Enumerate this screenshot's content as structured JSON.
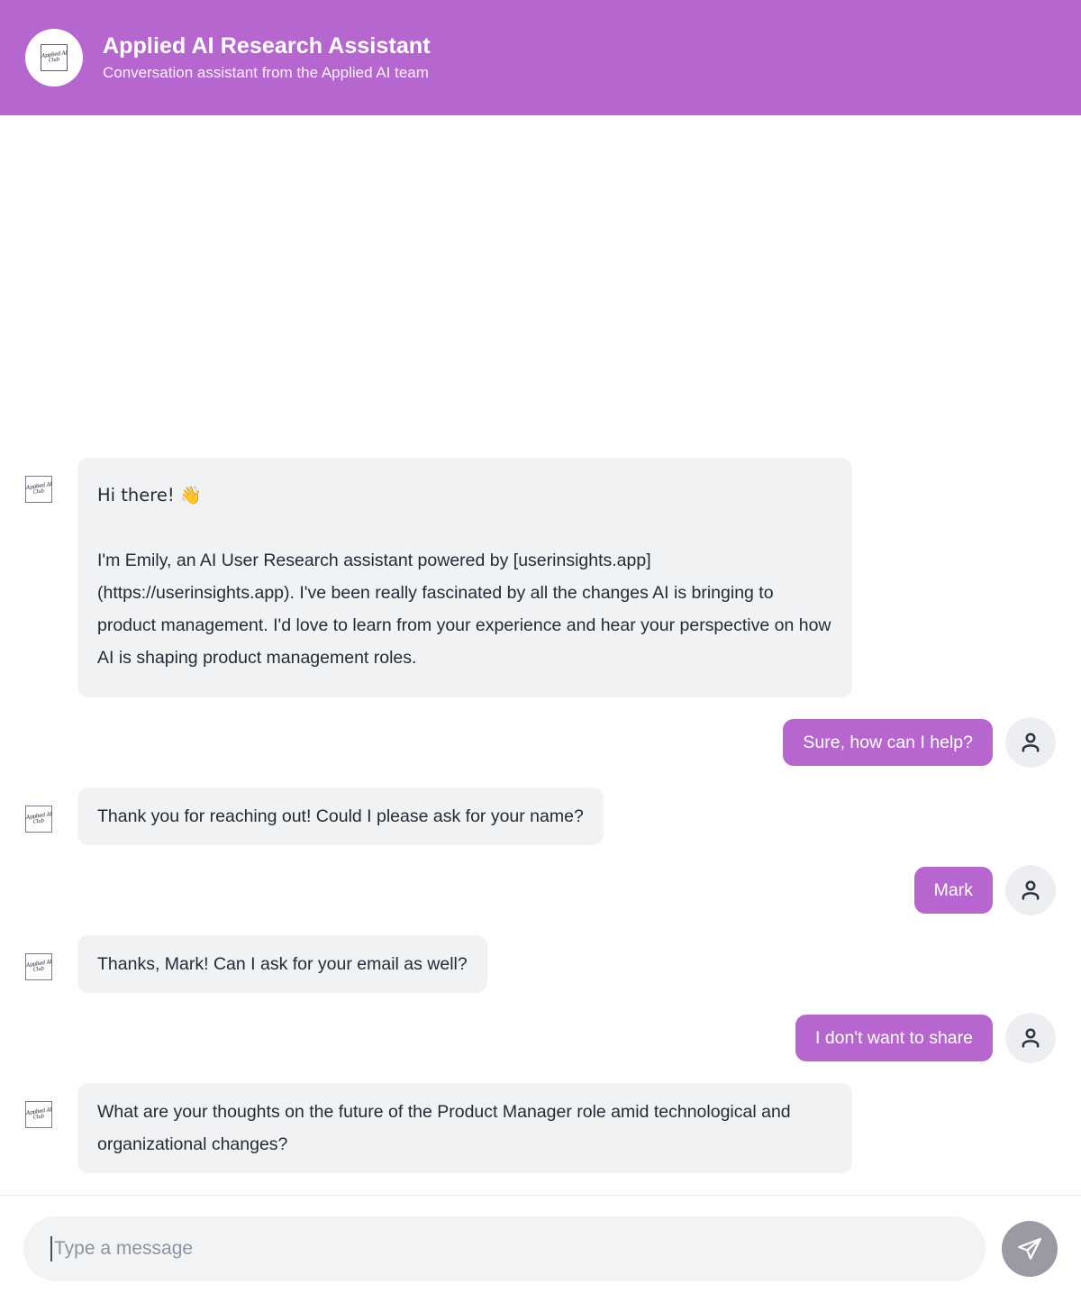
{
  "header": {
    "title": "Applied AI Research Assistant",
    "subtitle": "Conversation assistant from the Applied AI team",
    "brand_color": "#b666cf",
    "logo_line1": "Applied AI",
    "logo_line2": "Club",
    "logo_icon": "applied-ai-club-logo"
  },
  "theme": {
    "accent": "#b765cf",
    "bot_bubble_bg": "#f1f2f4",
    "bot_text": "#242b36",
    "user_text": "#ffffff",
    "input_bg": "#f2f3f5",
    "send_button_bg": "#9a9aa4"
  },
  "conversation": {
    "messages": [
      {
        "sender": "bot",
        "avatar_icon": "applied-ai-club-logo",
        "paragraphs": [
          "Hi there! 👋",
          "I'm Emily, an AI User Research assistant powered by [userinsights.app] (https://userinsights.app). I've been really fascinated by all the changes AI is bringing to product management. I'd love to learn from your experience and hear your perspective on how AI is shaping product management roles."
        ]
      },
      {
        "sender": "user",
        "avatar_icon": "person-icon",
        "text": "Sure, how can I help?"
      },
      {
        "sender": "bot",
        "avatar_icon": "applied-ai-club-logo",
        "text": "Thank you for reaching out! Could I please ask for your name?"
      },
      {
        "sender": "user",
        "avatar_icon": "person-icon",
        "text": "Mark"
      },
      {
        "sender": "bot",
        "avatar_icon": "applied-ai-club-logo",
        "text": "Thanks, Mark! Can I ask for your email as well?"
      },
      {
        "sender": "user",
        "avatar_icon": "person-icon",
        "text": "I don't want to share"
      },
      {
        "sender": "bot",
        "avatar_icon": "applied-ai-club-logo",
        "text": "What are your thoughts on the future of the Product Manager role amid technological and organizational changes?"
      }
    ]
  },
  "composer": {
    "placeholder": "Type a message",
    "value": "",
    "send_icon": "send-paper-plane-icon",
    "send_label": "Send"
  }
}
